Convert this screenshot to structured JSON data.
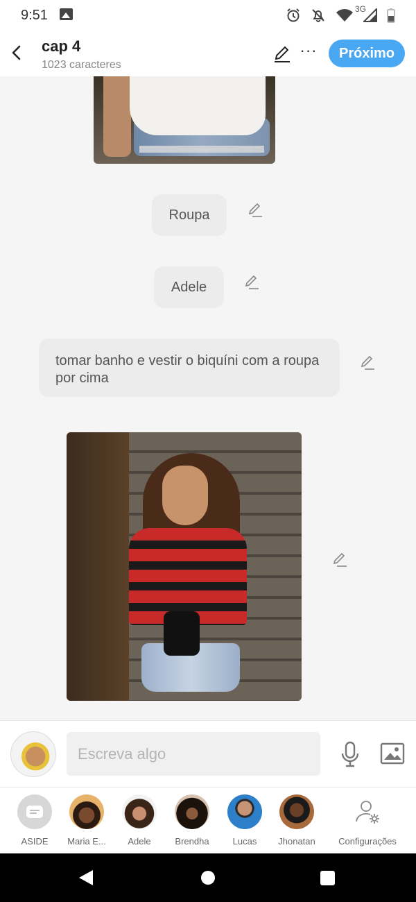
{
  "status_bar": {
    "time": "9:51",
    "network": "3G"
  },
  "header": {
    "title": "cap 4",
    "char_count": "1023 caracteres",
    "next_label": "Próximo",
    "more_glyph": "···"
  },
  "messages": [
    {
      "type": "image",
      "description_icon": "photo"
    },
    {
      "type": "text",
      "text": "Roupa"
    },
    {
      "type": "text",
      "text": "Adele"
    },
    {
      "type": "text",
      "text": "tomar banho e vestir o biquíni com a roupa por cima"
    },
    {
      "type": "image",
      "description_icon": "photo"
    }
  ],
  "compose": {
    "placeholder": "Escreva algo"
  },
  "characters": [
    {
      "label": "ASIDE"
    },
    {
      "label": "Maria E..."
    },
    {
      "label": "Adele"
    },
    {
      "label": "Brendha"
    },
    {
      "label": "Lucas"
    },
    {
      "label": "Jhonatan"
    },
    {
      "label": "Configurações"
    }
  ],
  "colors": {
    "accent": "#4aa8f3",
    "bubble": "#ececec",
    "background": "#f5f5f5"
  }
}
